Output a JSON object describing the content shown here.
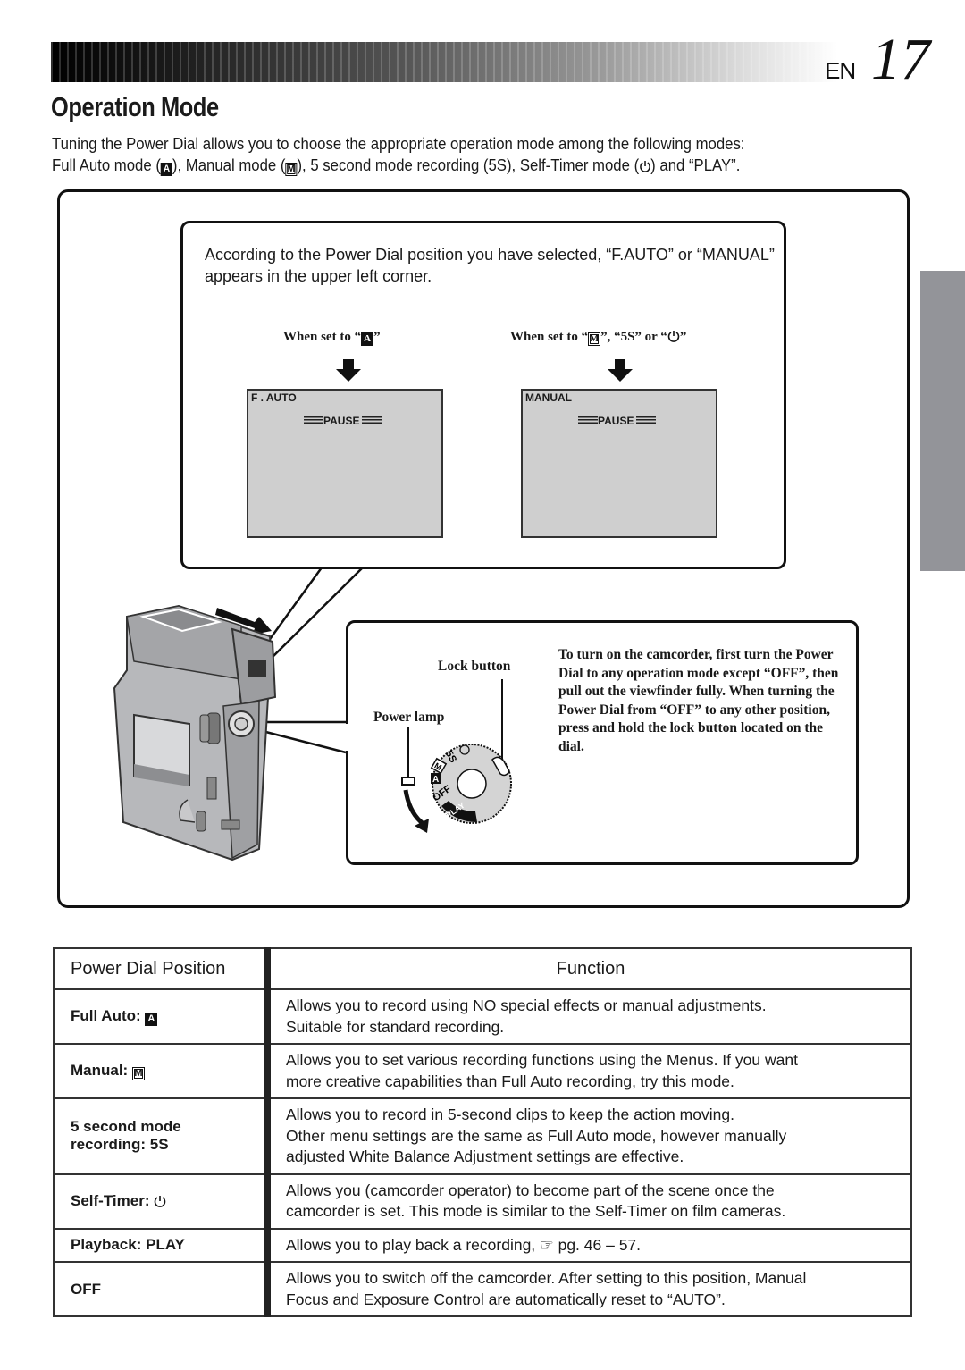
{
  "header": {
    "lang": "EN",
    "page_number": "17"
  },
  "page_title": "Operation Mode",
  "intro": {
    "line1": "Tuning the Power Dial allows you to choose the appropriate operation mode among the following modes:",
    "line2_parts": [
      "Full Auto mode (",
      "), Manual mode (",
      "), 5 second mode recording (5S), Self-Timer mode (",
      ") and “PLAY”."
    ]
  },
  "icons": {
    "full_auto": "A",
    "manual": "M",
    "self_timer": "self-timer-icon",
    "reference": "☞"
  },
  "callout_top": {
    "text": "According to the Power Dial position you have selected, “F.AUTO” or “MANUAL” appears in the upper left corner.",
    "left_label_pre": "When set to “",
    "left_label_post": "”",
    "right_label_parts": [
      "When set to “",
      "”, “5S” or “",
      "”"
    ],
    "screens": [
      {
        "mode_text": "F . AUTO",
        "status_text": "PAUSE"
      },
      {
        "mode_text": "MANUAL",
        "status_text": "PAUSE"
      }
    ]
  },
  "callout_bottom": {
    "lock_button_label": "Lock button",
    "power_lamp_label": "Power lamp",
    "instructions": "To turn on the camcorder, first turn the Power Dial to any operation mode except “OFF”,  then pull out the viewfinder fully. When turning the Power Dial from “OFF” to any other position, press and hold the lock button located on the dial.",
    "dial_labels": [
      "5S",
      "M",
      "A",
      "OFF",
      "PLAY"
    ]
  },
  "table": {
    "headers": [
      "Power Dial Position",
      "Function"
    ],
    "rows": [
      {
        "position": "Full Auto: ",
        "icon": "A",
        "function": [
          "Allows you to record using NO special effects or manual adjustments.",
          "Suitable for standard recording."
        ]
      },
      {
        "position": "Manual: ",
        "icon": "M",
        "function": [
          "Allows you to set various recording functions using the Menus. If you want",
          "more creative capabilities than Full Auto recording, try this mode."
        ]
      },
      {
        "position": "5 second mode recording: 5S",
        "icon": "",
        "function": [
          "Allows you to record in 5-second clips to keep the action moving.",
          "Other menu settings are the same as Full Auto mode, however manually",
          "adjusted White Balance Adjustment settings are effective."
        ]
      },
      {
        "position": "Self-Timer: ",
        "icon": "self-timer",
        "function": [
          "Allows you (camcorder operator) to become part of the scene once the",
          "camcorder is set. This mode is similar to the Self-Timer on film cameras."
        ]
      },
      {
        "position": "Playback: PLAY",
        "icon": "",
        "function": [
          "Allows you to play back a recording, ☞ pg. 46 – 57."
        ]
      },
      {
        "position": "OFF",
        "icon": "",
        "function": [
          "Allows you to switch off the camcorder. After setting to this position, Manual",
          "Focus and Exposure Control are automatically reset to “AUTO”."
        ]
      }
    ]
  }
}
